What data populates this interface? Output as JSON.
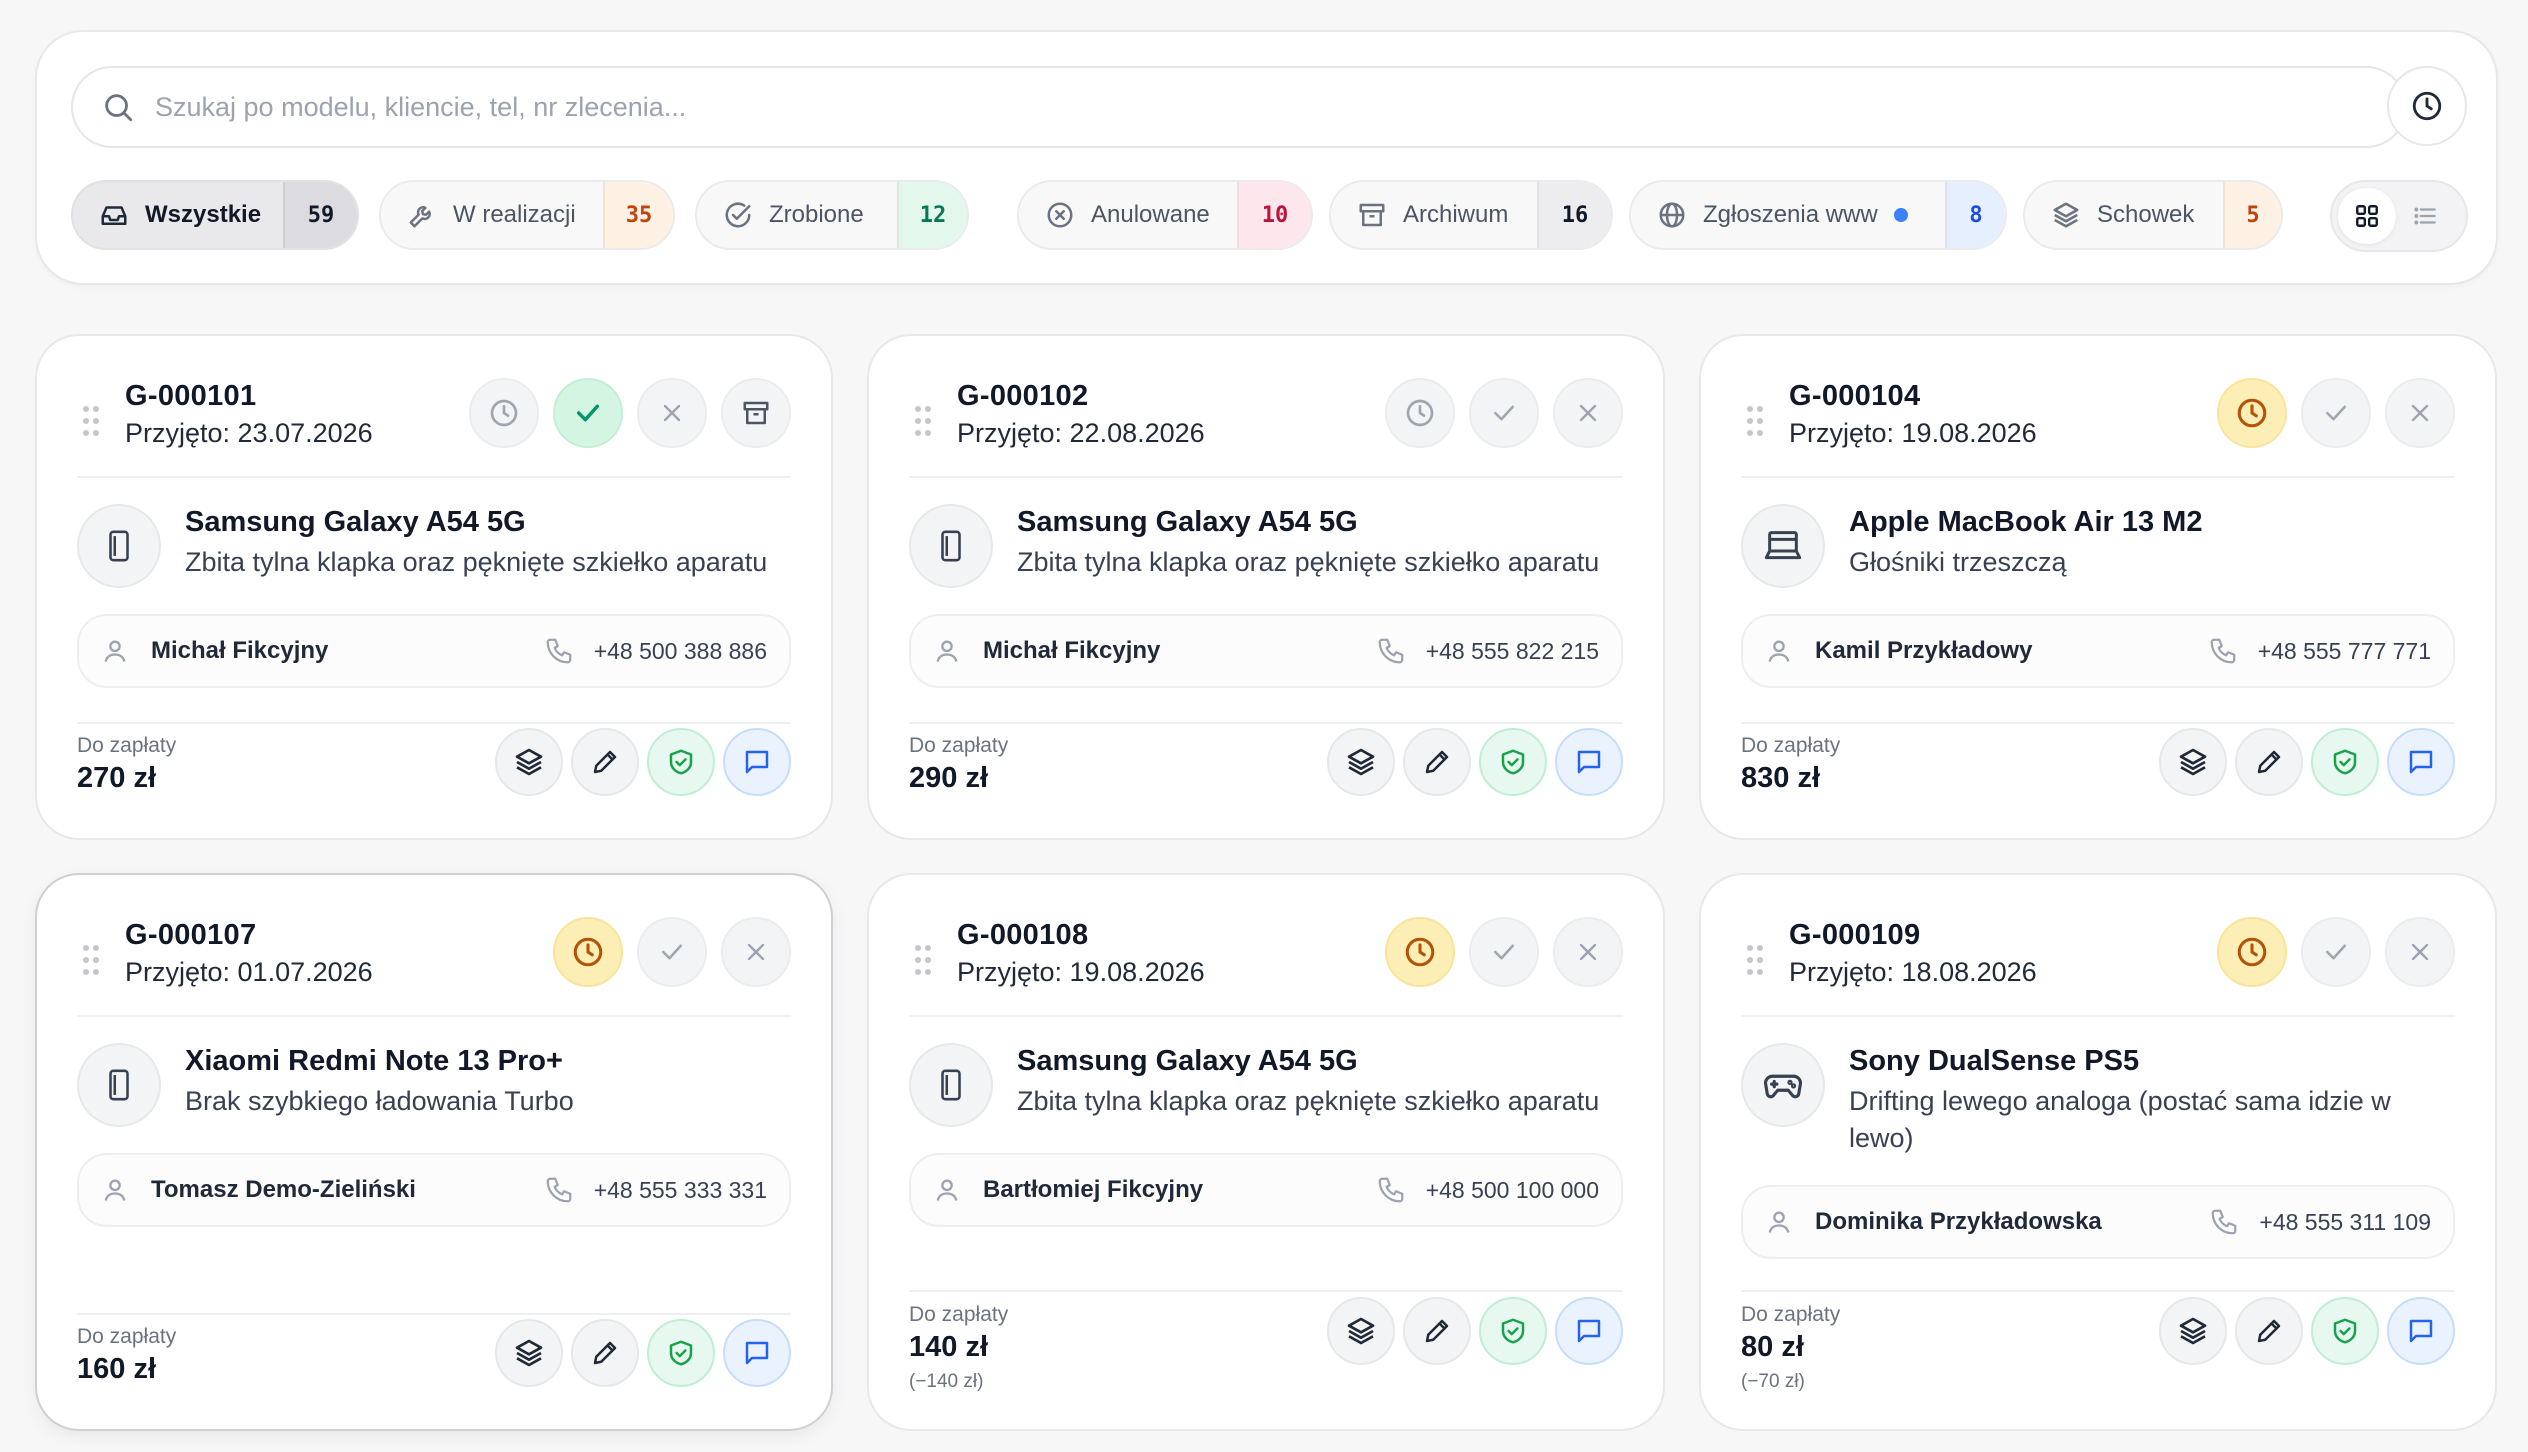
{
  "search": {
    "placeholder": "Szukaj po modelu, kliencie, tel, nr zlecenia..."
  },
  "filters": [
    {
      "label": "Wszystkie",
      "count": "59",
      "icon": "inbox-icon",
      "active": true
    },
    {
      "label": "W realizacji",
      "count": "35",
      "icon": "wrench-icon"
    },
    {
      "label": "Zrobione",
      "count": "12",
      "icon": "check-circle-icon"
    },
    {
      "label": "Anulowane",
      "count": "10",
      "icon": "x-circle-icon"
    },
    {
      "label": "Archiwum",
      "count": "16",
      "icon": "archive-icon"
    },
    {
      "label": "Zgłoszenia www",
      "count": "8",
      "icon": "globe-icon",
      "has_dot": true
    },
    {
      "label": "Schowek",
      "count": "5",
      "icon": "layers-icon"
    }
  ],
  "colors": {
    "count_default": "#111827",
    "count_orange": "#c2410c",
    "count_green": "#047857",
    "count_red": "#be123c",
    "count_blue": "#1d4ed8",
    "pending": "#fdeeb5",
    "done": "#d5f5e3",
    "shield": "#16a34a",
    "chat": "#2563eb"
  },
  "pay_label": "Do zapłaty",
  "orders": [
    {
      "id": "G-000101",
      "received": "Przyjęto: 23.07.2026",
      "status": "done",
      "archive_button": true,
      "device_icon": "phone-device-icon",
      "device": "Samsung Galaxy A54 5G",
      "issue": "Zbita tylna klapka oraz pęknięte szkiełko aparatu",
      "client": "Michał Fikcyjny",
      "phone": "+48 500 388 886",
      "amount": "270 zł"
    },
    {
      "id": "G-000102",
      "received": "Przyjęto: 22.08.2026",
      "status": "none",
      "device_icon": "phone-device-icon",
      "device": "Samsung Galaxy A54 5G",
      "issue": "Zbita tylna klapka oraz pęknięte szkiełko aparatu",
      "client": "Michał Fikcyjny",
      "phone": "+48 555 822 215",
      "amount": "290 zł"
    },
    {
      "id": "G-000104",
      "received": "Przyjęto: 19.08.2026",
      "status": "pending",
      "device_icon": "laptop-device-icon",
      "device": "Apple MacBook Air 13 M2",
      "issue": "Głośniki trzeszczą",
      "client": "Kamil Przykładowy",
      "phone": "+48 555 777 771",
      "amount": "830 zł"
    },
    {
      "id": "G-000107",
      "received": "Przyjęto: 01.07.2026",
      "status": "pending",
      "device_icon": "phone-device-icon",
      "device": "Xiaomi Redmi Note 13 Pro+",
      "issue": "Brak szybkiego ładowania Turbo",
      "client": "Tomasz Demo-Zieliński",
      "phone": "+48 555 333 331",
      "amount": "160 zł"
    },
    {
      "id": "G-000108",
      "received": "Przyjęto: 19.08.2026",
      "status": "pending",
      "device_icon": "phone-device-icon",
      "device": "Samsung Galaxy A54 5G",
      "issue": "Zbita tylna klapka oraz pęknięte szkiełko aparatu",
      "client": "Bartłomiej Fikcyjny",
      "phone": "+48 500 100 000",
      "amount": "140 zł",
      "amount_sub": "(−140 zł)"
    },
    {
      "id": "G-000109",
      "received": "Przyjęto: 18.08.2026",
      "status": "pending",
      "device_icon": "gamepad-device-icon",
      "device": "Sony DualSense PS5",
      "issue": "Drifting lewego analoga (postać sama idzie w lewo)",
      "client": "Dominika Przykładowska",
      "phone": "+48 555 311 109",
      "amount": "80 zł",
      "amount_sub": "(−70 zł)"
    }
  ]
}
